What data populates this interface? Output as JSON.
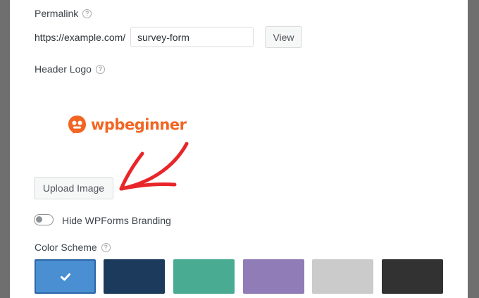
{
  "permalink": {
    "label": "Permalink",
    "prefix": "https://example.com/",
    "slug": "survey-form",
    "view_label": "View"
  },
  "header_logo": {
    "label": "Header Logo",
    "logo_text": "wpbeginner",
    "upload_label": "Upload Image"
  },
  "branding": {
    "label": "Hide WPForms Branding",
    "enabled": false
  },
  "color_scheme": {
    "label": "Color Scheme",
    "swatches": [
      {
        "name": "blue",
        "color": "#4a8fd2",
        "selected": true
      },
      {
        "name": "navy",
        "color": "#1b3a5c",
        "selected": false
      },
      {
        "name": "teal",
        "color": "#4aab93",
        "selected": false
      },
      {
        "name": "purple",
        "color": "#907cb6",
        "selected": false
      },
      {
        "name": "light-gray",
        "color": "#cbcbcb",
        "selected": false
      },
      {
        "name": "charcoal",
        "color": "#323232",
        "selected": false
      }
    ]
  },
  "colors": {
    "brand_orange": "#f26522",
    "annotation_arrow": "#e8262a"
  },
  "icons": {
    "help": "question-circle-icon",
    "check": "check-icon",
    "logo_mark": "wpbeginner-logo-icon"
  }
}
